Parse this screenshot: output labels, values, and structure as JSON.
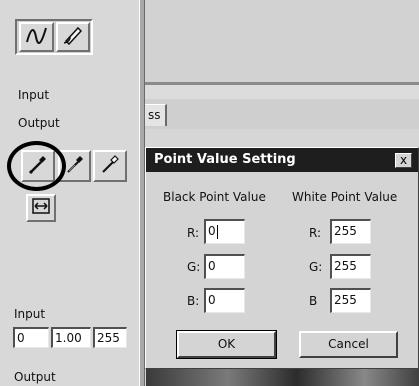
{
  "left_panel": {
    "tools": [
      {
        "icon": "curve-icon"
      },
      {
        "icon": "pencil-icon"
      }
    ],
    "input_label": "Input",
    "output_label": "Output",
    "eyedroppers": [
      {
        "icon": "black-eyedropper-icon"
      },
      {
        "icon": "gray-eyedropper-icon"
      },
      {
        "icon": "white-eyedropper-icon"
      }
    ],
    "reset_icon": "auto-adjust-icon",
    "levels": {
      "label": "Input",
      "values": [
        "0",
        "1.00",
        "255"
      ]
    },
    "bottom_label": "Output"
  },
  "tab": {
    "label": "ss"
  },
  "dialog": {
    "title": "Point Value Setting",
    "close_label": "x",
    "black_header": "Black Point Value",
    "white_header": "White Point Value",
    "black": [
      {
        "label": "R:",
        "value": "0"
      },
      {
        "label": "G:",
        "value": "0"
      },
      {
        "label": "B:",
        "value": "0"
      }
    ],
    "white": [
      {
        "label": "R:",
        "value": "255"
      },
      {
        "label": "G:",
        "value": "255"
      },
      {
        "label": "B",
        "value": "255"
      }
    ],
    "ok_label": "OK",
    "cancel_label": "Cancel"
  }
}
